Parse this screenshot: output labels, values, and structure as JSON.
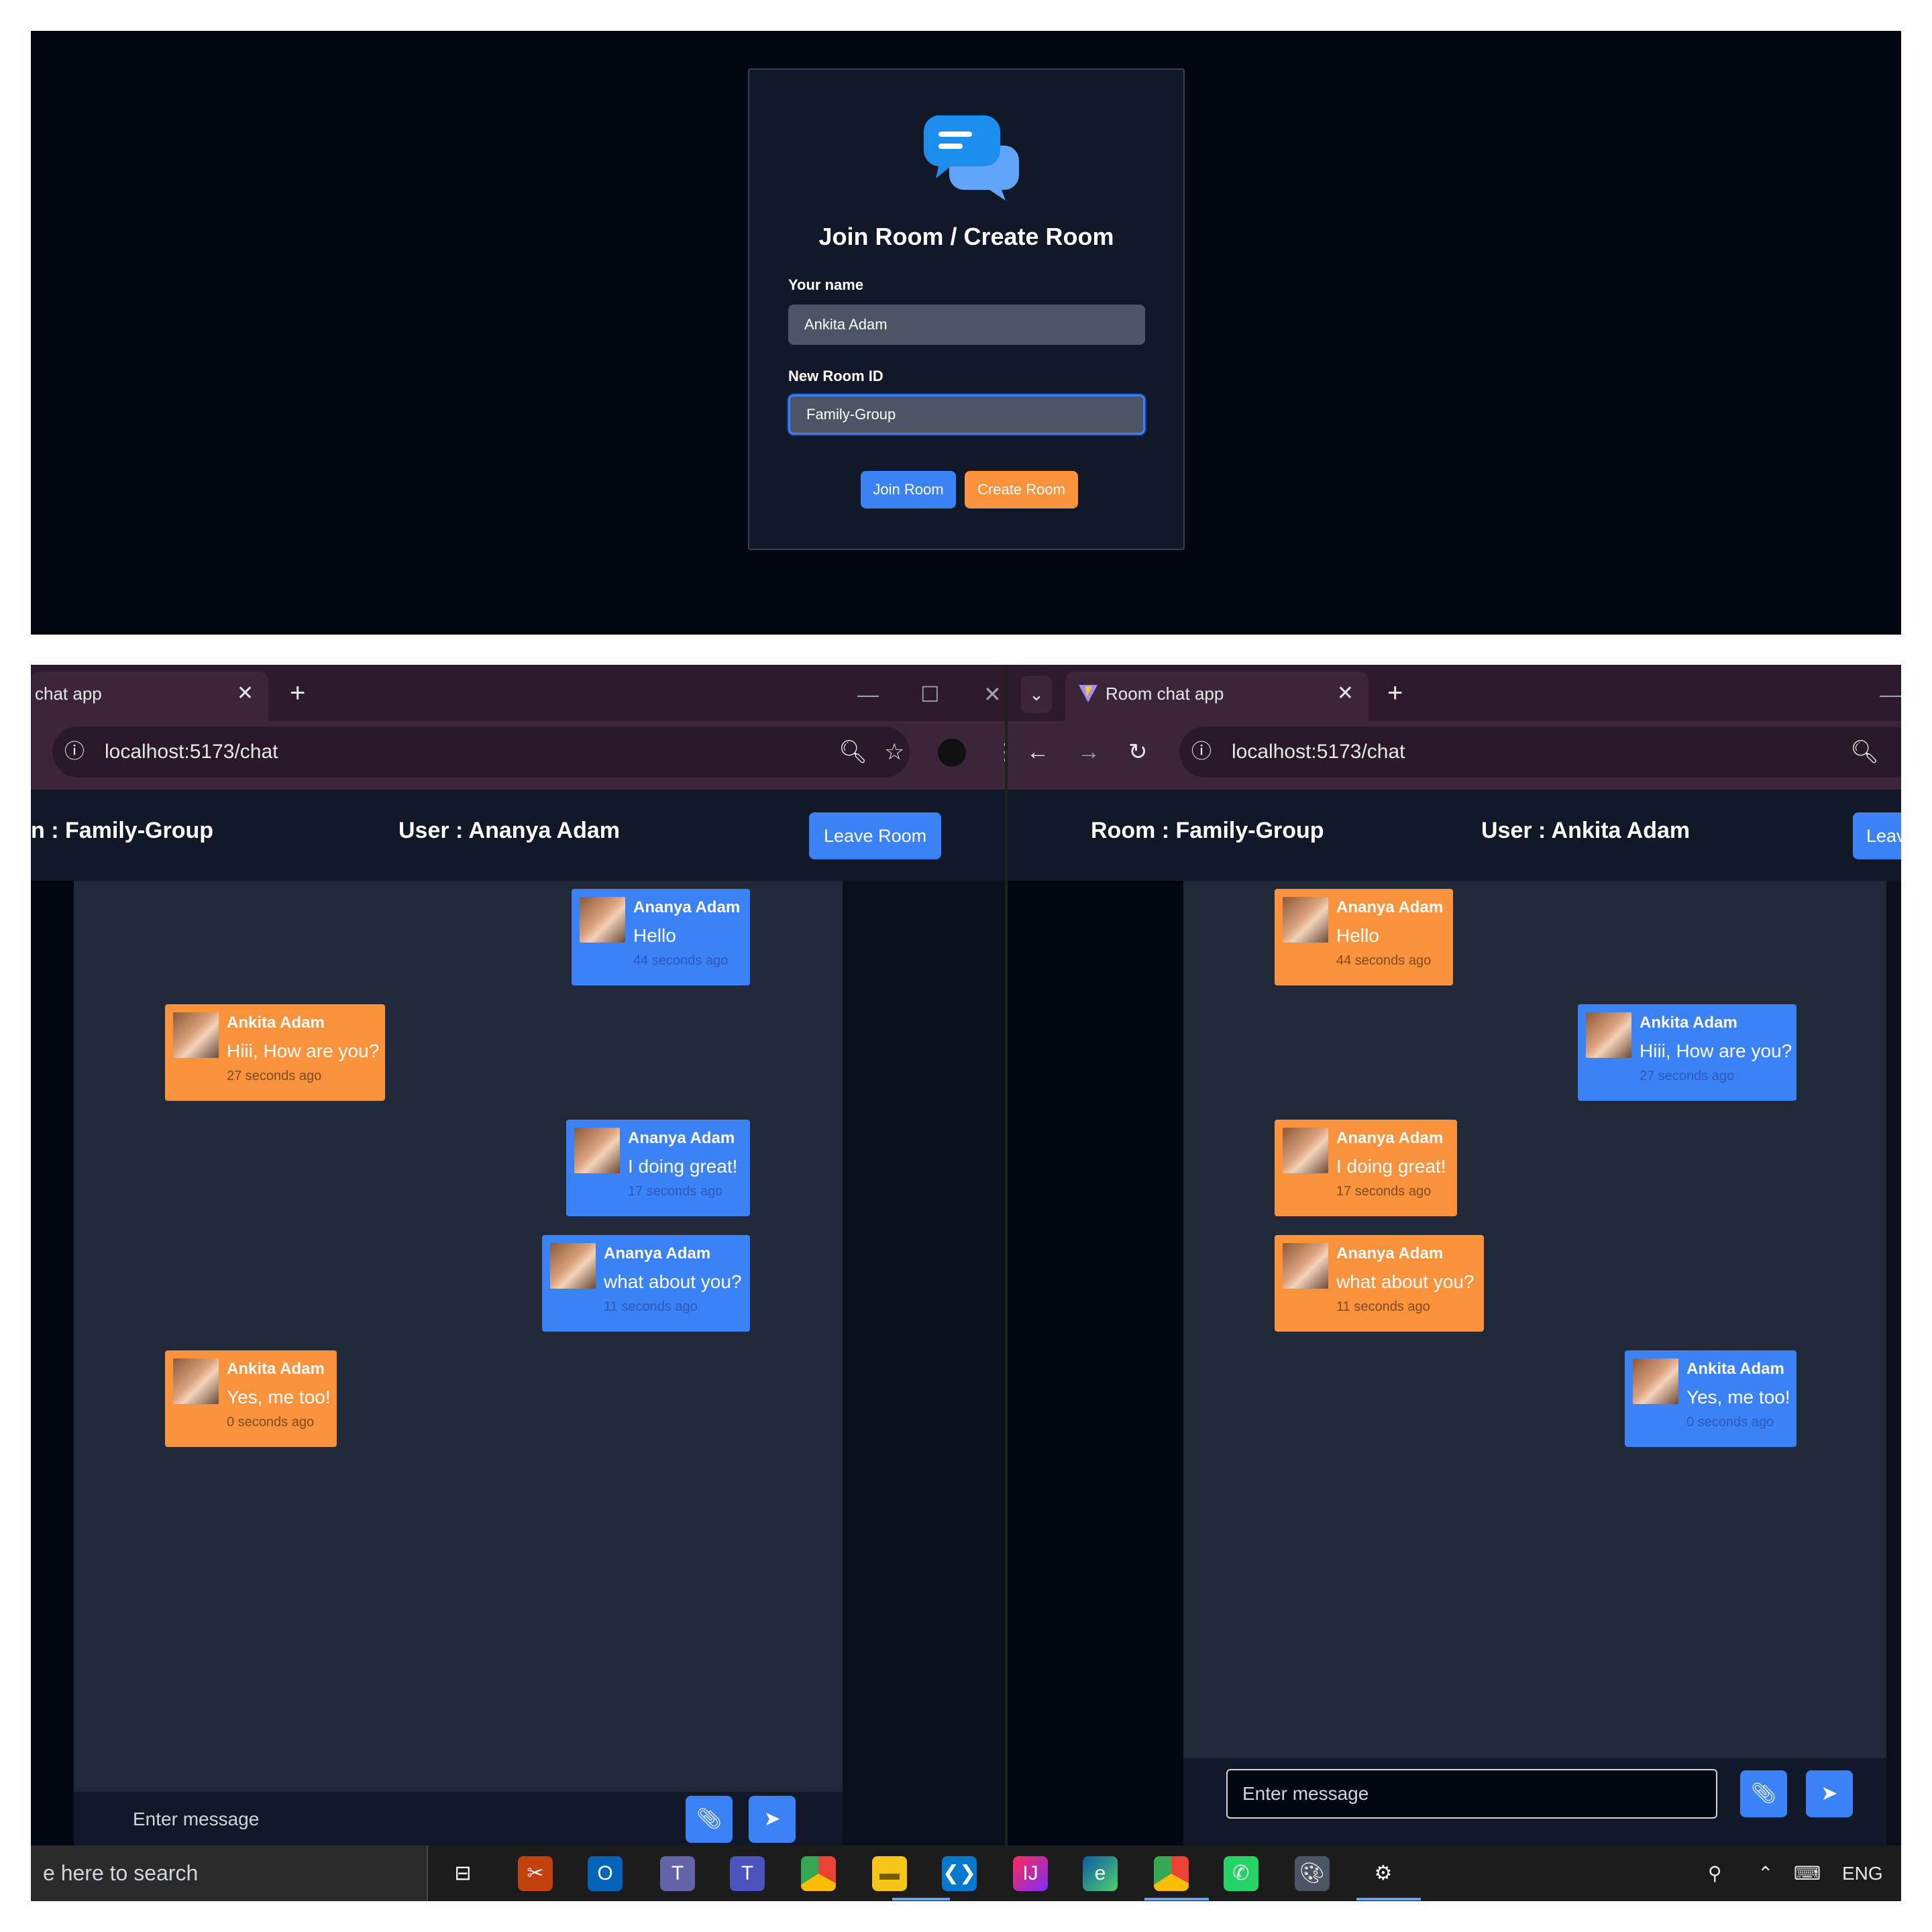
{
  "join_form": {
    "title": "Join Room / Create Room",
    "name_label": "Your name",
    "name_value": "Ankita Adam",
    "room_label": "New Room ID",
    "room_value": "Family-Group",
    "join_button": "Join Room",
    "create_button": "Create Room"
  },
  "left_window": {
    "tab_title": "chat app",
    "url": "localhost:5173/chat",
    "room_label": "n : Family-Group",
    "user_label": "User : Ananya Adam",
    "leave_button": "Leave Room",
    "messages": [
      {
        "sender": "Ananya Adam",
        "text": "Hello",
        "time": "44 seconds ago",
        "own": true
      },
      {
        "sender": "Ankita Adam",
        "text": "Hiii, How are you?",
        "time": "27 seconds ago",
        "own": false
      },
      {
        "sender": "Ananya Adam",
        "text": "I doing great!",
        "time": "17 seconds ago",
        "own": true
      },
      {
        "sender": "Ananya Adam",
        "text": "what about you?",
        "time": "11 seconds ago",
        "own": true
      },
      {
        "sender": "Ankita Adam",
        "text": "Yes, me too!",
        "time": "0 seconds ago",
        "own": false
      }
    ],
    "input_placeholder": "Enter message"
  },
  "right_window": {
    "tab_title": "Room chat app",
    "url": "localhost:5173/chat",
    "room_label": "Room : Family-Group",
    "user_label": "User : Ankita Adam",
    "leave_button": "Leav",
    "messages": [
      {
        "sender": "Ananya Adam",
        "text": "Hello",
        "time": "44 seconds ago",
        "own": false
      },
      {
        "sender": "Ankita Adam",
        "text": "Hiii, How are you?",
        "time": "27 seconds ago",
        "own": true
      },
      {
        "sender": "Ananya Adam",
        "text": "I doing great!",
        "time": "17 seconds ago",
        "own": false
      },
      {
        "sender": "Ananya Adam",
        "text": "what about you?",
        "time": "11 seconds ago",
        "own": false
      },
      {
        "sender": "Ankita Adam",
        "text": "Yes, me too!",
        "time": "0 seconds ago",
        "own": true
      }
    ],
    "input_placeholder": "Enter message"
  },
  "taskbar": {
    "search_text": "e here to search",
    "language": "ENG"
  },
  "colors": {
    "blue_bubble": "#3b82f6",
    "orange_bubble": "#fb923c",
    "chat_bg": "#1f2937",
    "page_bg": "#030712"
  }
}
